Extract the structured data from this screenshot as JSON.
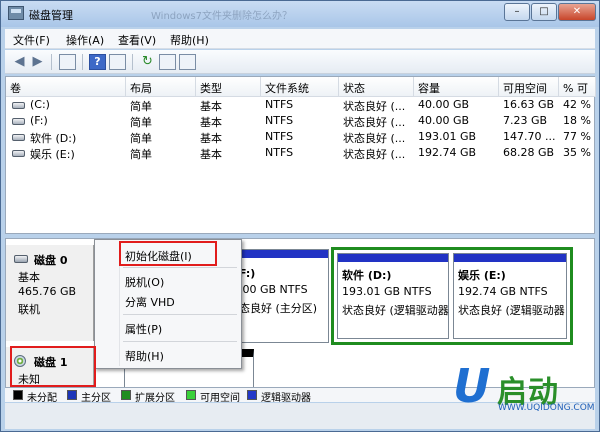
{
  "window": {
    "title": "磁盘管理",
    "ghost_title": "Windows7文件夹删除怎么办？",
    "buttons": {
      "min": "–",
      "max": "□",
      "close": "✕"
    }
  },
  "menu": [
    "文件(F)",
    "操作(A)",
    "查看(V)",
    "帮助(H)"
  ],
  "toolbar": {
    "back_icon": "back-arrow-icon",
    "forward_icon": "forward-arrow-icon",
    "help_glyph": "?",
    "refresh_glyph": "↻"
  },
  "volumes": {
    "headers": [
      "卷",
      "布局",
      "类型",
      "文件系统",
      "状态",
      "容量",
      "可用空间",
      "% 可"
    ],
    "rows": [
      [
        "(C:)",
        "简单",
        "基本",
        "NTFS",
        "状态良好 (...",
        "40.00 GB",
        "16.63 GB",
        "42 %"
      ],
      [
        "(F:)",
        "简单",
        "基本",
        "NTFS",
        "状态良好 (...",
        "40.00 GB",
        "7.23 GB",
        "18 %"
      ],
      [
        "软件 (D:)",
        "简单",
        "基本",
        "NTFS",
        "状态良好 (...",
        "193.01 GB",
        "147.70 ...",
        "77 %"
      ],
      [
        "娱乐 (E:)",
        "简单",
        "基本",
        "NTFS",
        "状态良好 (...",
        "192.74 GB",
        "68.28 GB",
        "35 %"
      ]
    ]
  },
  "disks": {
    "disk0": {
      "name": "磁盘 0",
      "type": "基本",
      "size": "465.76 GB",
      "status": "联机",
      "partitions": [
        {
          "title": "F:)",
          "line1": ".00 GB NTFS",
          "line2": "态良好 (主分区)"
        },
        {
          "title": "软件  (D:)",
          "line1": "193.01 GB NTFS",
          "line2": "状态良好 (逻辑驱动器"
        },
        {
          "title": "娱乐  (E:)",
          "line1": "192.74 GB NTFS",
          "line2": "状态良好 (逻辑驱动器"
        }
      ]
    },
    "disk1": {
      "name": "磁盘 1",
      "status": "未知"
    }
  },
  "legend": [
    {
      "label": "未分配",
      "color": "#000000"
    },
    {
      "label": "主分区",
      "color": "#1d36b8"
    },
    {
      "label": "扩展分区",
      "color": "#1f8c1f"
    },
    {
      "label": "可用空间",
      "color": "#3ad13a"
    },
    {
      "label": "逻辑驱动器",
      "color": "#2438c9"
    }
  ],
  "context_menu": {
    "items": [
      "初始化磁盘(I)",
      "脱机(O)",
      "分离 VHD",
      "属性(P)",
      "帮助(H)"
    ]
  },
  "watermark": {
    "letter": "U",
    "text": "启动",
    "url": "WWW.UQIDONG.COM"
  }
}
